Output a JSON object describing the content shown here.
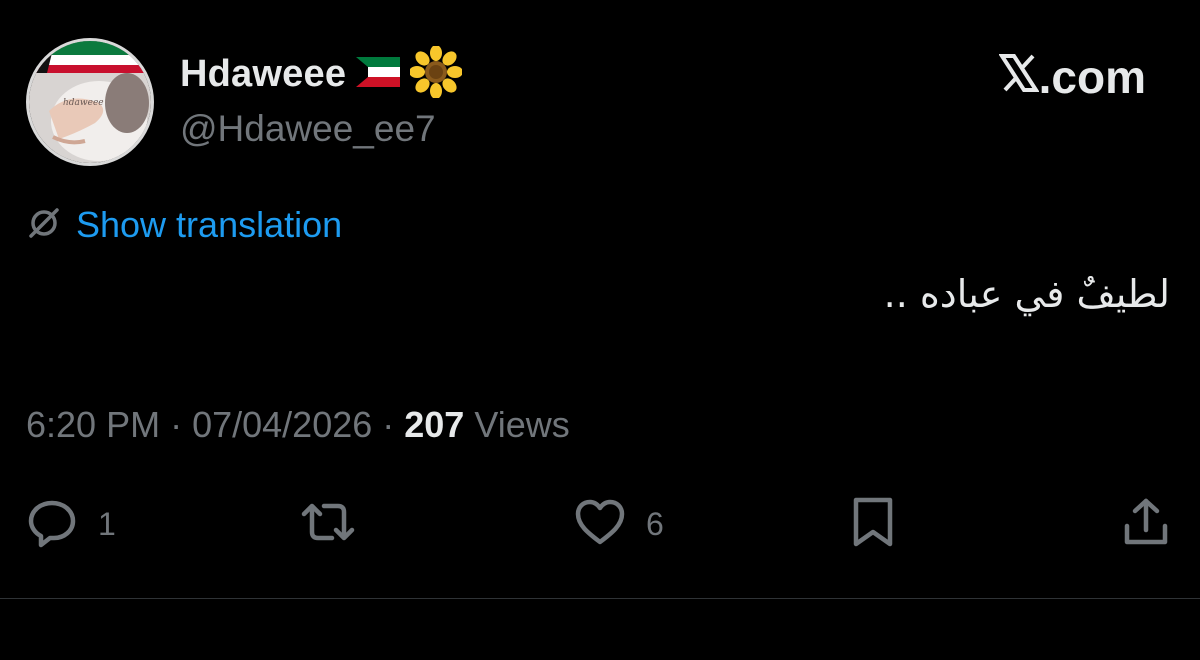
{
  "header": {
    "display_name": "Hdaweee",
    "handle": "@Hdawee_ee7",
    "flag_icon": "kuwait-flag-icon",
    "flower_icon": "sunflower-icon",
    "site_label": ".com",
    "site_icon": "x-logo-icon"
  },
  "translation": {
    "label": "Show translation",
    "icon": "translate-icon",
    "color": "#1d9bf0"
  },
  "tweet": {
    "text": "لطيفٌ في عباده .."
  },
  "meta": {
    "time": "6:20 PM",
    "separator1": " · ",
    "date": "07/04/2026",
    "separator2": " · ",
    "views_count": "207",
    "views_label": " Views"
  },
  "actions": {
    "reply_count": "1",
    "retweet_count": "",
    "like_count": "6"
  },
  "colors": {
    "background": "#000000",
    "text_primary": "#e7e9ea",
    "text_secondary": "#71767b",
    "accent": "#1d9bf0",
    "divider": "#2f3336"
  }
}
